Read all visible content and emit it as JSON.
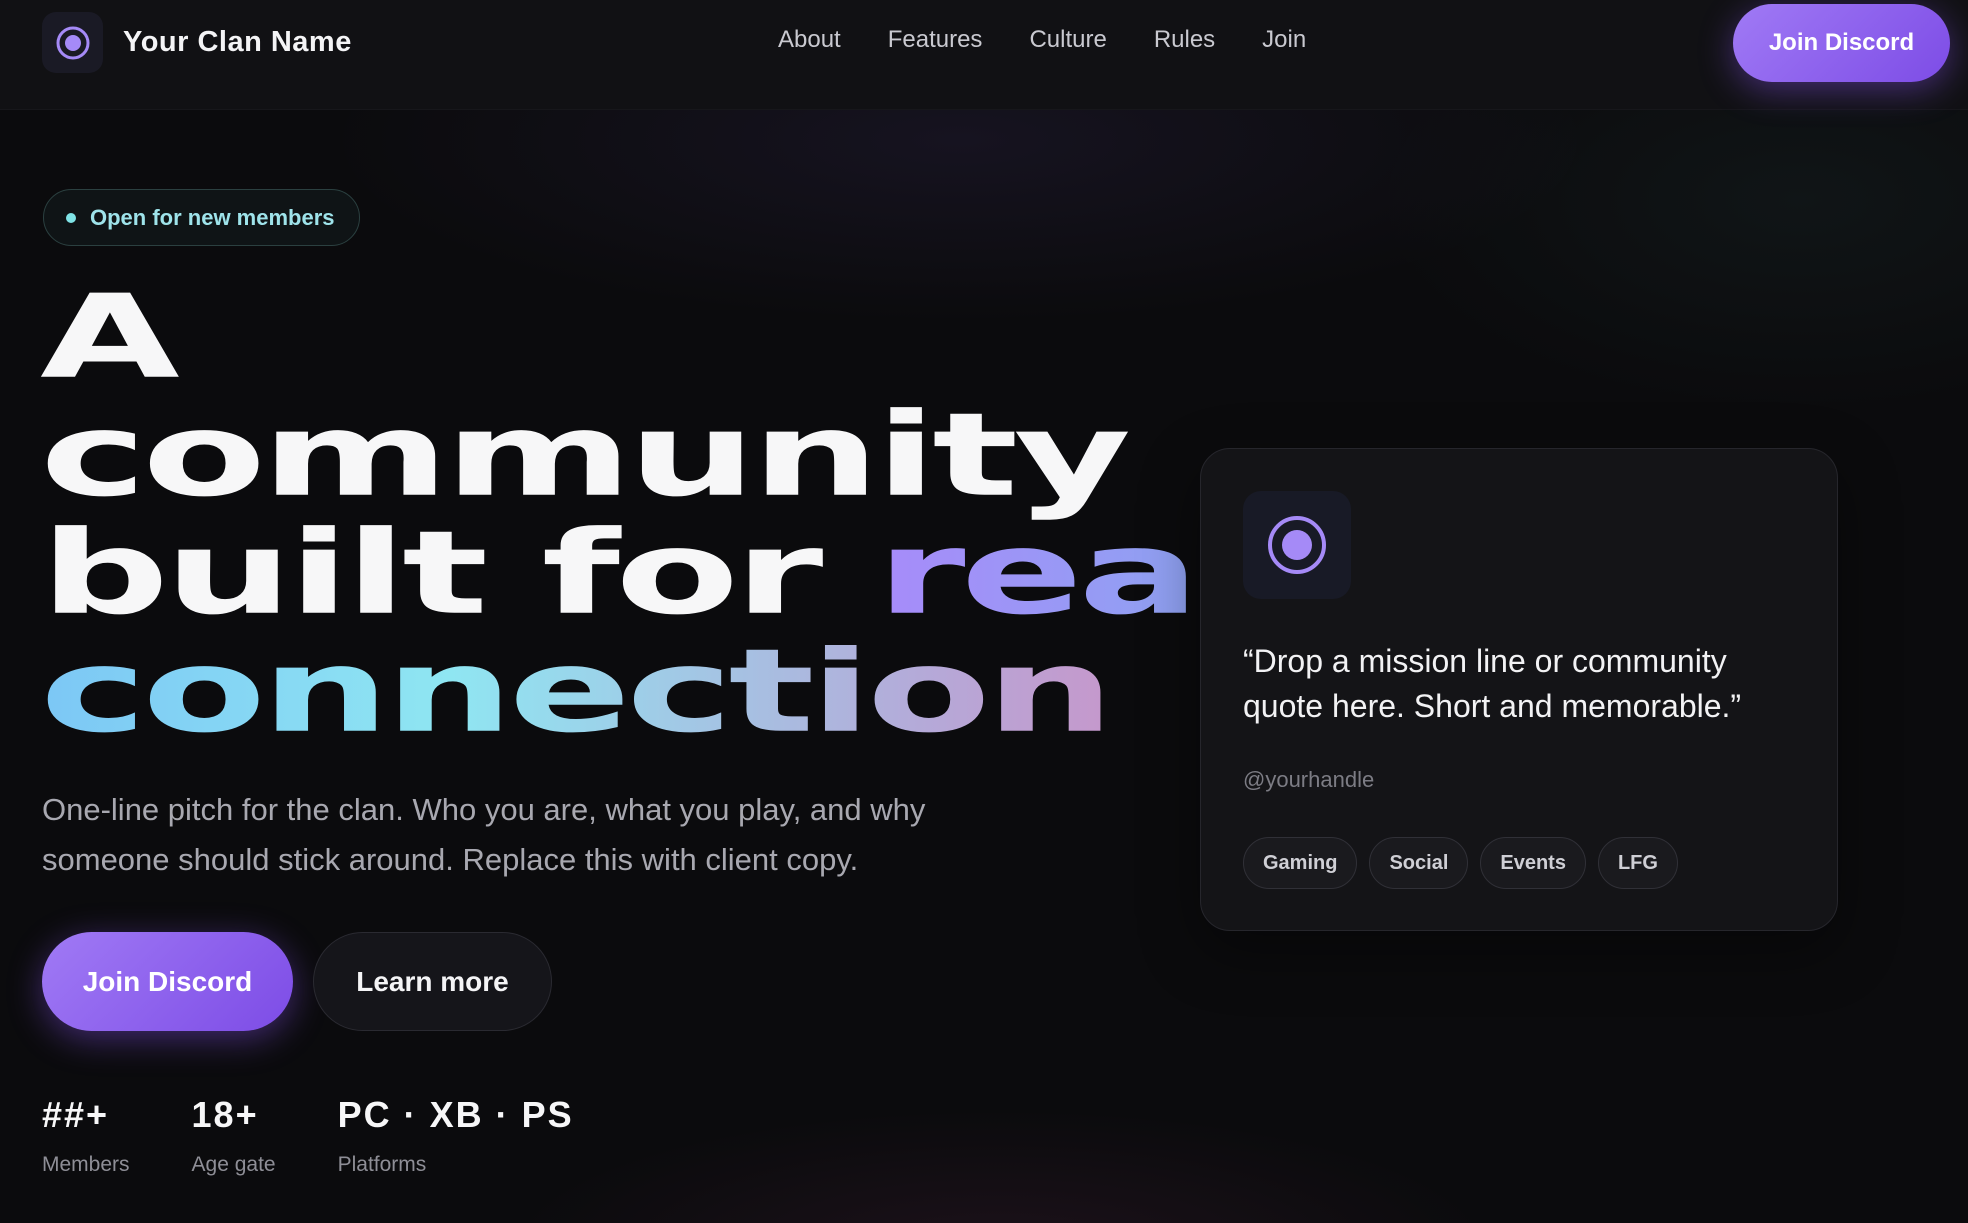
{
  "header": {
    "brand_name": "Your Clan Name",
    "nav": [
      "About",
      "Features",
      "Culture",
      "Rules",
      "Join"
    ],
    "cta": "Join Discord"
  },
  "hero": {
    "badge": "Open for new members",
    "headline": {
      "line1": "A",
      "line2": "community",
      "line3_plain": "built for ",
      "line3_accent": "real",
      "line4_accent": "connection"
    },
    "pitch": "One-line pitch for the clan. Who you are, what you play, and why someone should stick around. Replace this with client copy.",
    "primary_cta": "Join Discord",
    "secondary_cta": "Learn more",
    "stats": [
      {
        "value": "##+",
        "label": "Members"
      },
      {
        "value": "18+",
        "label": "Age gate"
      },
      {
        "value": "PC · XB · PS",
        "label": "Platforms"
      }
    ]
  },
  "card": {
    "quote": "“Drop a mission line or community quote here. Short and memorable.”",
    "handle": "@yourhandle",
    "tags": [
      "Gaming",
      "Social",
      "Events",
      "LFG"
    ]
  },
  "colors": {
    "accent": "#8b5cf6",
    "badge_text": "#9ee3ea",
    "background": "#0b0b0d"
  },
  "icons": {
    "brand": "target-circle-icon",
    "card": "target-circle-icon"
  }
}
